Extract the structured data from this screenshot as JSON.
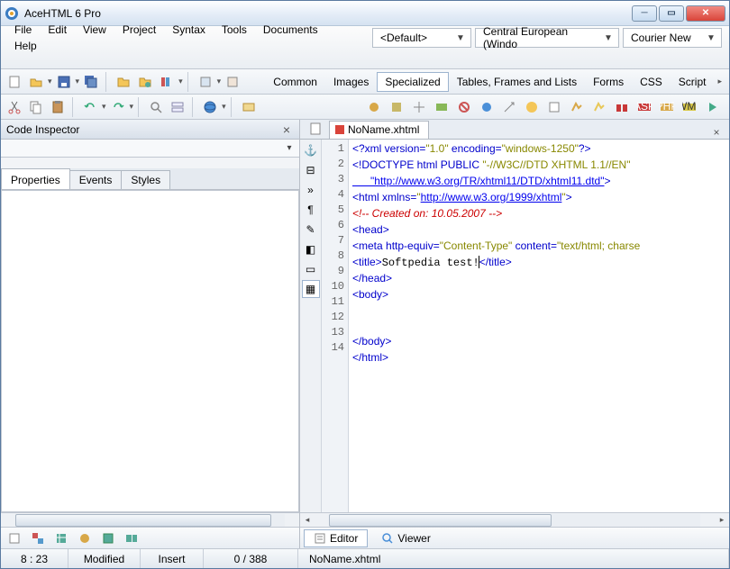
{
  "window": {
    "title": "AceHTML 6 Pro"
  },
  "menu": [
    "File",
    "Edit",
    "View",
    "Project",
    "Syntax",
    "Tools",
    "Documents",
    "Help"
  ],
  "combos": {
    "preset": "<Default>",
    "encoding": "Central European (Windo",
    "font": "Courier New"
  },
  "panel": {
    "title": "Code Inspector",
    "tabs": [
      "Properties",
      "Events",
      "Styles"
    ],
    "activeTab": 0
  },
  "catTabs": [
    "Common",
    "Images",
    "Specialized",
    "Tables, Frames and Lists",
    "Forms",
    "CSS",
    "Script"
  ],
  "catActive": 2,
  "fileTab": "NoName.xhtml",
  "viewTabs": [
    "Editor",
    "Viewer"
  ],
  "viewActive": 0,
  "status": {
    "pos": "8 : 23",
    "state": "Modified",
    "mode": "Insert",
    "sel": "0 / 388",
    "file": "NoName.xhtml"
  },
  "code": {
    "lines": [
      1,
      2,
      3,
      4,
      5,
      6,
      7,
      8,
      9,
      10,
      11,
      12,
      13,
      14
    ],
    "l1_a": "<?xml version=",
    "l1_b": "\"1.0\"",
    "l1_c": " encoding=",
    "l1_d": "\"windows-1250\"",
    "l1_e": "?>",
    "l2_a": "<!DOCTYPE html PUBLIC ",
    "l2_b": "\"-//W3C//DTD XHTML 1.1//EN\"",
    "l2c": "      \"http://www.w3.org/TR/xhtml11/DTD/xhtml11.dtd\"",
    "l2d": ">",
    "l3_a": "<html xmlns=",
    "l3_b": "\"",
    "l3_c": "http://www.w3.org/1999/xhtml",
    "l3_d": "\"",
    "l3_e": ">",
    "l4": "<!-- Created on: 10.05.2007 -->",
    "l5": "<head>",
    "l6_a": "<meta http-equiv=",
    "l6_b": "\"Content-Type\"",
    "l6_c": " content=",
    "l6_d": "\"text/html; charse",
    "l7_a": "<title>",
    "l7_b": "Softpedia test!",
    "l7_c": "</title>",
    "l8": "</head>",
    "l9": "<body>",
    "l10": "",
    "l11": "",
    "l12": "</body>",
    "l13": "</html>"
  }
}
